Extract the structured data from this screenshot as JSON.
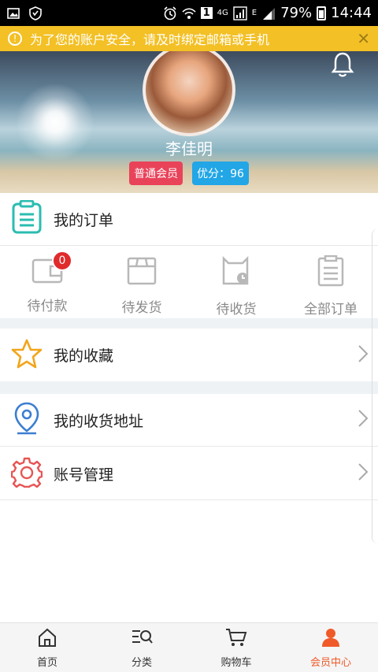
{
  "status_bar": {
    "battery_percent": "79%",
    "time": "14:44",
    "network": "4G",
    "sim_slot": "1",
    "signal_mark": "E"
  },
  "notice": {
    "text": "为了您的账户安全，请及时绑定邮箱或手机",
    "close_icon": "close-icon"
  },
  "profile": {
    "name": "李佳明",
    "member_badge": "普通会员",
    "points_badge": "优分：96",
    "colors": {
      "member": "#e9435a",
      "points": "#22a6e6"
    }
  },
  "orders": {
    "title": "我的订单",
    "items": [
      {
        "label": "待付款",
        "count": "0",
        "icon": "wallet-icon"
      },
      {
        "label": "待发货",
        "icon": "box-icon"
      },
      {
        "label": "待收货",
        "icon": "bag-clock-icon"
      },
      {
        "label": "全部订单",
        "icon": "clipboard-list-icon"
      }
    ]
  },
  "rows": {
    "favorites": "我的收藏",
    "address": "我的收货地址",
    "account": "账号管理"
  },
  "bottom_nav": {
    "items": [
      {
        "label": "首页",
        "icon": "home-icon"
      },
      {
        "label": "分类",
        "icon": "category-search-icon"
      },
      {
        "label": "购物车",
        "icon": "cart-icon"
      },
      {
        "label": "会员中心",
        "icon": "user-icon",
        "active": true
      }
    ],
    "active_color": "#f05a28"
  }
}
